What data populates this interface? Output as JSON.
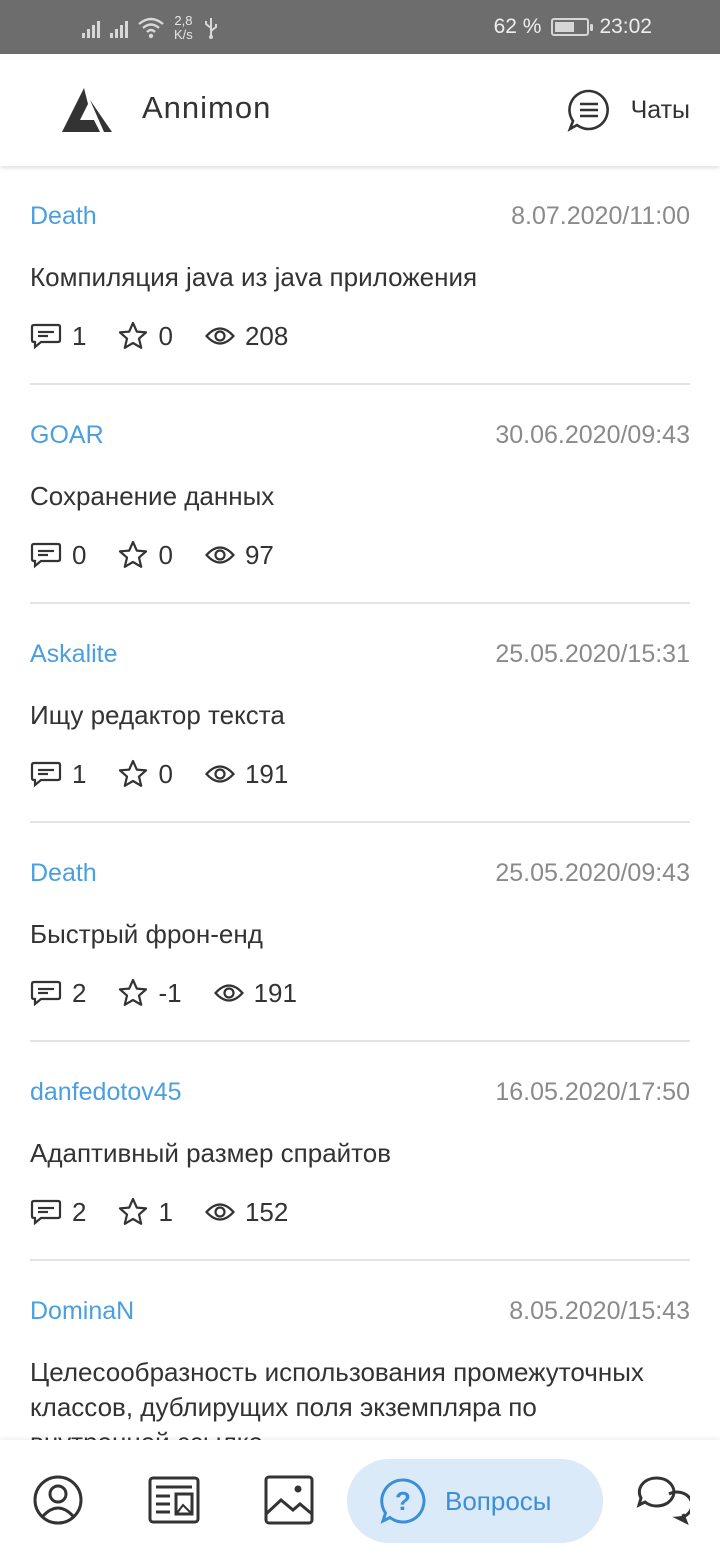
{
  "status_bar": {
    "speed_value": "2,8",
    "speed_unit": "K/s",
    "battery": "62 %",
    "battery_level": 0.62,
    "time": "23:02"
  },
  "app_bar": {
    "title": "Annimon",
    "chats_label": "Чаты"
  },
  "questions": [
    {
      "author": "Death",
      "date": "8.07.2020/11:00",
      "title": "Компиляция java из java приложения",
      "comments": "1",
      "rating": "0",
      "views": "208"
    },
    {
      "author": "GOAR",
      "date": "30.06.2020/09:43",
      "title": "Сохранение данных",
      "comments": "0",
      "rating": "0",
      "views": "97"
    },
    {
      "author": "Askalite",
      "date": "25.05.2020/15:31",
      "title": "Ищу редактор текста",
      "comments": "1",
      "rating": "0",
      "views": "191"
    },
    {
      "author": "Death",
      "date": "25.05.2020/09:43",
      "title": "Быстрый фрон-енд",
      "comments": "2",
      "rating": "-1",
      "views": "191"
    },
    {
      "author": "danfedotov45",
      "date": "16.05.2020/17:50",
      "title": "Адаптивный размер спрайтов",
      "comments": "2",
      "rating": "1",
      "views": "152"
    },
    {
      "author": "DominaN",
      "date": "8.05.2020/15:43",
      "title": "Целесообразность использования промежуточных классов, дублирущих поля экземпляра по внутренней ссылке",
      "comments": "",
      "rating": "",
      "views": ""
    }
  ],
  "bottom_nav": {
    "active_label": "Вопросы",
    "items": [
      "profile-icon",
      "news-icon",
      "gallery-icon",
      "questions-icon",
      "chat-bubbles-icon"
    ]
  },
  "colors": {
    "accent": "#4a9fde",
    "active_pill": "#dbeaf8",
    "status_bar": "#6d6d6d"
  }
}
